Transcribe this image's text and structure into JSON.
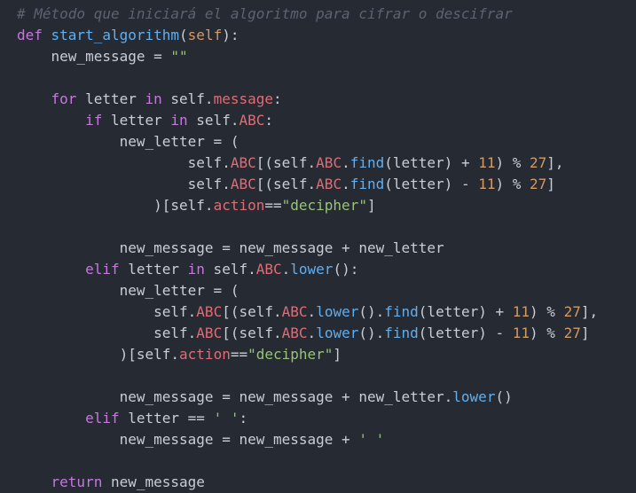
{
  "theme": {
    "background": "#262a33",
    "text": "#c8cdd6",
    "comment": "#5c6370",
    "keyword": "#c678dd",
    "function": "#61afef",
    "string": "#98c379",
    "number": "#d19a66",
    "attribute": "#e06c75"
  },
  "code": {
    "lines": [
      [
        [
          "comment",
          "# Método que iniciará el algoritmo para cifrar o descifrar"
        ]
      ],
      [
        [
          "kw",
          "def "
        ],
        [
          "fn",
          "start_algorithm"
        ],
        [
          "plain",
          "("
        ],
        [
          "param",
          "self"
        ],
        [
          "plain",
          "):"
        ]
      ],
      [
        [
          "plain",
          "    new_message = "
        ],
        [
          "str",
          "\"\""
        ]
      ],
      [],
      [
        [
          "plain",
          "    "
        ],
        [
          "kw",
          "for"
        ],
        [
          "plain",
          " letter "
        ],
        [
          "kw",
          "in"
        ],
        [
          "plain",
          " self."
        ],
        [
          "attr",
          "message"
        ],
        [
          "plain",
          ":"
        ]
      ],
      [
        [
          "plain",
          "        "
        ],
        [
          "kw",
          "if"
        ],
        [
          "plain",
          " letter "
        ],
        [
          "kw",
          "in"
        ],
        [
          "plain",
          " self."
        ],
        [
          "attr",
          "ABC"
        ],
        [
          "plain",
          ":"
        ]
      ],
      [
        [
          "plain",
          "            new_letter = ("
        ]
      ],
      [
        [
          "plain",
          "                    self."
        ],
        [
          "attr",
          "ABC"
        ],
        [
          "plain",
          "[(self."
        ],
        [
          "attr",
          "ABC"
        ],
        [
          "plain",
          "."
        ],
        [
          "fn",
          "find"
        ],
        [
          "plain",
          "(letter) + "
        ],
        [
          "num",
          "11"
        ],
        [
          "plain",
          ") % "
        ],
        [
          "num",
          "27"
        ],
        [
          "plain",
          "],"
        ]
      ],
      [
        [
          "plain",
          "                    self."
        ],
        [
          "attr",
          "ABC"
        ],
        [
          "plain",
          "[(self."
        ],
        [
          "attr",
          "ABC"
        ],
        [
          "plain",
          "."
        ],
        [
          "fn",
          "find"
        ],
        [
          "plain",
          "(letter) - "
        ],
        [
          "num",
          "11"
        ],
        [
          "plain",
          ") % "
        ],
        [
          "num",
          "27"
        ],
        [
          "plain",
          "]"
        ]
      ],
      [
        [
          "plain",
          "                )[self."
        ],
        [
          "attr",
          "action"
        ],
        [
          "plain",
          "=="
        ],
        [
          "str",
          "\"decipher\""
        ],
        [
          "plain",
          "]"
        ]
      ],
      [],
      [
        [
          "plain",
          "            new_message = new_message + new_letter"
        ]
      ],
      [
        [
          "plain",
          "        "
        ],
        [
          "kw",
          "elif"
        ],
        [
          "plain",
          " letter "
        ],
        [
          "kw",
          "in"
        ],
        [
          "plain",
          " self."
        ],
        [
          "attr",
          "ABC"
        ],
        [
          "plain",
          "."
        ],
        [
          "fn",
          "lower"
        ],
        [
          "plain",
          "():"
        ]
      ],
      [
        [
          "plain",
          "            new_letter = ("
        ]
      ],
      [
        [
          "plain",
          "                self."
        ],
        [
          "attr",
          "ABC"
        ],
        [
          "plain",
          "[(self."
        ],
        [
          "attr",
          "ABC"
        ],
        [
          "plain",
          "."
        ],
        [
          "fn",
          "lower"
        ],
        [
          "plain",
          "()."
        ],
        [
          "fn",
          "find"
        ],
        [
          "plain",
          "(letter) + "
        ],
        [
          "num",
          "11"
        ],
        [
          "plain",
          ") % "
        ],
        [
          "num",
          "27"
        ],
        [
          "plain",
          "],"
        ]
      ],
      [
        [
          "plain",
          "                self."
        ],
        [
          "attr",
          "ABC"
        ],
        [
          "plain",
          "[(self."
        ],
        [
          "attr",
          "ABC"
        ],
        [
          "plain",
          "."
        ],
        [
          "fn",
          "lower"
        ],
        [
          "plain",
          "()."
        ],
        [
          "fn",
          "find"
        ],
        [
          "plain",
          "(letter) - "
        ],
        [
          "num",
          "11"
        ],
        [
          "plain",
          ") % "
        ],
        [
          "num",
          "27"
        ],
        [
          "plain",
          "]"
        ]
      ],
      [
        [
          "plain",
          "            )[self."
        ],
        [
          "attr",
          "action"
        ],
        [
          "plain",
          "=="
        ],
        [
          "str",
          "\"decipher\""
        ],
        [
          "plain",
          "]"
        ]
      ],
      [],
      [
        [
          "plain",
          "            new_message = new_message + new_letter."
        ],
        [
          "fn",
          "lower"
        ],
        [
          "plain",
          "()"
        ]
      ],
      [
        [
          "plain",
          "        "
        ],
        [
          "kw",
          "elif"
        ],
        [
          "plain",
          " letter == "
        ],
        [
          "str",
          "' '"
        ],
        [
          "plain",
          ":"
        ]
      ],
      [
        [
          "plain",
          "            new_message = new_message + "
        ],
        [
          "str",
          "' '"
        ]
      ],
      [],
      [
        [
          "plain",
          "    "
        ],
        [
          "kw",
          "return"
        ],
        [
          "plain",
          " new_message"
        ]
      ]
    ]
  }
}
